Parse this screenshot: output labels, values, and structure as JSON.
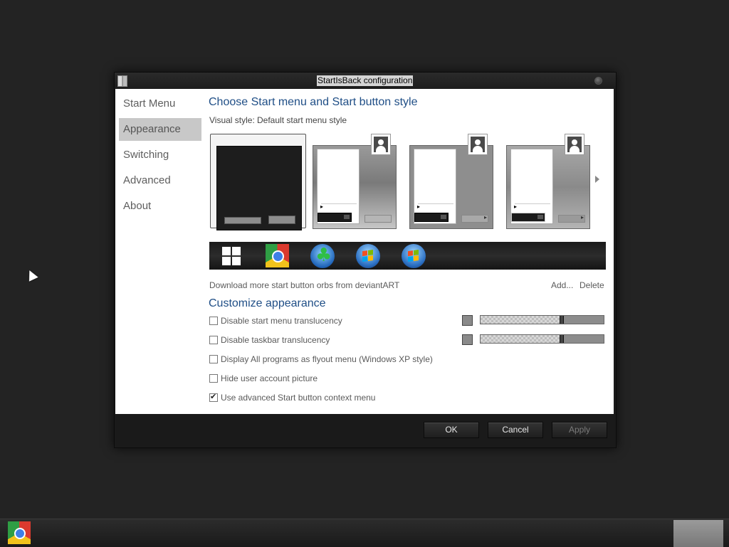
{
  "window": {
    "title": "StartIsBack configuration"
  },
  "nav": {
    "items": [
      {
        "label": "Start Menu"
      },
      {
        "label": "Appearance"
      },
      {
        "label": "Switching"
      },
      {
        "label": "Advanced"
      },
      {
        "label": "About"
      }
    ],
    "selected": "Appearance"
  },
  "content": {
    "style_section_title": "Choose Start menu and Start button style",
    "visual_style_label": "Visual style:",
    "visual_style_value": "Default start menu style",
    "styles": [
      {
        "name": "default-dark",
        "selected": true
      },
      {
        "name": "light-gradient",
        "selected": false
      },
      {
        "name": "light-flat",
        "selected": false
      },
      {
        "name": "light-flat-2",
        "selected": false
      }
    ],
    "orbs": [
      {
        "icon": "windows-8-logo-icon"
      },
      {
        "icon": "chrome-orb-icon"
      },
      {
        "icon": "clover-orb-icon"
      },
      {
        "icon": "windows-7-orb-icon"
      },
      {
        "icon": "windows-7-orb-icon-alt"
      }
    ],
    "download_link": "Download more start button orbs from deviantART",
    "add_link": "Add...",
    "delete_link": "Delete",
    "customize_title": "Customize appearance",
    "options": [
      {
        "label": "Disable start menu translucency",
        "checked": false
      },
      {
        "label": "Disable taskbar translucency",
        "checked": false
      },
      {
        "label": "Display All programs as flyout menu (Windows XP style)",
        "checked": false
      },
      {
        "label": "Hide user account picture",
        "checked": false
      },
      {
        "label": "Use advanced Start button context menu",
        "checked": true
      }
    ],
    "sliders": [
      {
        "for": "start menu translucency",
        "value": 0.66
      },
      {
        "for": "taskbar translucency",
        "value": 0.66
      }
    ]
  },
  "footer": {
    "ok_label": "OK",
    "cancel_label": "Cancel",
    "apply_label": "Apply",
    "apply_enabled": false
  },
  "taskbar": {
    "pinned": [
      {
        "icon": "chrome-icon"
      }
    ]
  },
  "colors": {
    "accent_title": "#1f4e86",
    "nav_selected_bg": "#c8c8c8",
    "window_frame": "#1a1a1a"
  }
}
